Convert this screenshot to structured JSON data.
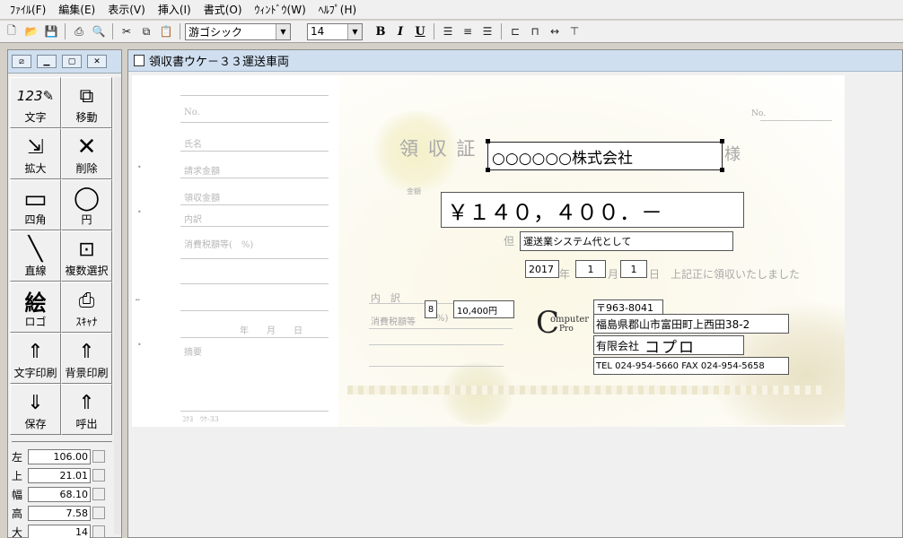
{
  "menu": [
    "ﾌｧｲﾙ(F)",
    "編集(E)",
    "表示(V)",
    "挿入(I)",
    "書式(O)",
    "ｳｨﾝﾄﾞｳ(W)",
    "ﾍﾙﾌﾟ(H)"
  ],
  "toolbar": {
    "font_name": "游ゴシック",
    "font_size": "14",
    "bold": "B",
    "italic": "I",
    "underline": "U"
  },
  "tools": [
    {
      "label": "文字",
      "icon": "text-tool-icon",
      "glyph": "123✎"
    },
    {
      "label": "移動",
      "icon": "move-tool-icon",
      "glyph": "⧉"
    },
    {
      "label": "拡大",
      "icon": "resize-tool-icon",
      "glyph": "⇲"
    },
    {
      "label": "削除",
      "icon": "delete-tool-icon",
      "glyph": "✕"
    },
    {
      "label": "四角",
      "icon": "rectangle-tool-icon",
      "glyph": "▭"
    },
    {
      "label": "円",
      "icon": "circle-tool-icon",
      "glyph": "◯"
    },
    {
      "label": "直線",
      "icon": "line-tool-icon",
      "glyph": "╲"
    },
    {
      "label": "複数選択",
      "icon": "multi-select-tool-icon",
      "glyph": "⊡"
    },
    {
      "label": "ロゴ",
      "icon": "logo-tool-icon",
      "glyph": "絵"
    },
    {
      "label": "ｽｷｬﾅ",
      "icon": "scanner-tool-icon",
      "glyph": "⎙"
    },
    {
      "label": "文字印刷",
      "icon": "print-text-icon",
      "glyph": "⇑"
    },
    {
      "label": "背景印刷",
      "icon": "print-background-icon",
      "glyph": "⇑"
    },
    {
      "label": "保存",
      "icon": "save-icon",
      "glyph": "⇓"
    },
    {
      "label": "呼出",
      "icon": "open-icon",
      "glyph": "⇑"
    }
  ],
  "props": [
    {
      "label": "左",
      "value": "106.00"
    },
    {
      "label": "上",
      "value": "21.01"
    },
    {
      "label": "幅",
      "value": "68.10"
    },
    {
      "label": "高",
      "value": "7.58"
    },
    {
      "label": "大",
      "value": "14"
    }
  ],
  "document": {
    "title": "領収書ウケ－３３運送車両",
    "stub": {
      "no": "No.",
      "name": "氏名",
      "billed": "請求金額",
      "received": "領収金額",
      "breakdown": "内訳",
      "tax": "消費税額等(　%)",
      "date": "年　　月　　日",
      "memo": "摘要",
      "code": "ｺｸﾖ　ｳｹ-33"
    },
    "receipt": {
      "heading": "領 収 証",
      "sama": "様",
      "no": "No.",
      "amount_label": "金額",
      "tadashi": "但",
      "date_suffix_year": "年",
      "date_suffix_month": "月",
      "date_suffix_day": "日",
      "received_text": "上記正に領収いたしました",
      "breakdown": "内　訳",
      "tax_label": "消費税額等",
      "tax_pct": "%)"
    },
    "fields": {
      "recipient": "○○○○○○株式会社",
      "amount": "￥１４０，４００．－",
      "purpose": "運送業システム代として",
      "year": "2017",
      "month": "1",
      "day": "1",
      "tax_rate": "8",
      "tax_amount": "10,400円",
      "zip": "〒963-8041",
      "address": "福島県郡山市富田町上西田38-2",
      "company_prefix": "有限会社",
      "company_name": "コプロ",
      "phone": "TEL 024-954-5660 FAX 024-954-5658"
    },
    "logo": {
      "big": "C",
      "line1": "omputer",
      "line2": "Pro"
    }
  }
}
